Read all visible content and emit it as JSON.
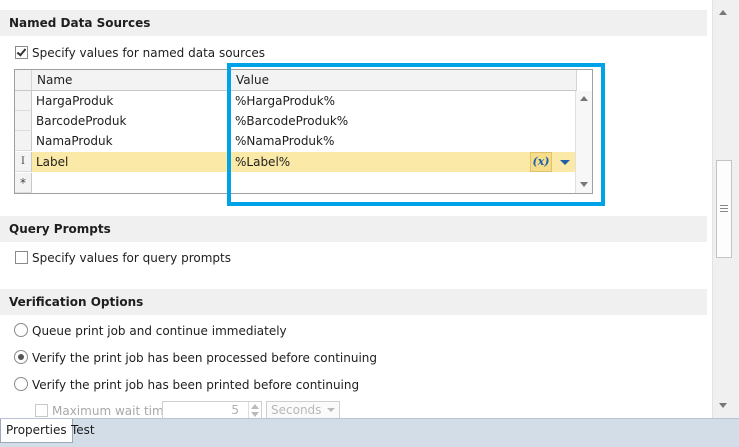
{
  "sections": {
    "named_data_sources": {
      "title": "Named Data Sources",
      "specify_label": "Specify values for named data sources",
      "specify_checked": true,
      "grid": {
        "columns": [
          "Name",
          "Value"
        ],
        "rows": [
          {
            "name": "HargaProduk",
            "value": "%HargaProduk%"
          },
          {
            "name": "BarcodeProduk",
            "value": "%BarcodeProduk%"
          },
          {
            "name": "NamaProduk",
            "value": "%NamaProduk%"
          },
          {
            "name": "Label",
            "value": "%Label%"
          }
        ],
        "active_row_index": 3,
        "new_row_marker": "*",
        "edit_marker": "I",
        "fx_label": "(x)"
      }
    },
    "query_prompts": {
      "title": "Query Prompts",
      "specify_label": "Specify values for query prompts",
      "specify_checked": false
    },
    "verification": {
      "title": "Verification Options",
      "options": [
        {
          "label": "Queue print job and continue immediately",
          "selected": false
        },
        {
          "label": "Verify the print job has been processed before continuing",
          "selected": true
        },
        {
          "label": "Verify the print job has been printed before continuing",
          "selected": false
        }
      ],
      "max_wait_label": "Maximum wait time",
      "max_wait_value": "5",
      "max_wait_unit": "Seconds"
    }
  },
  "tabs": [
    {
      "label": "Properties",
      "active": true
    },
    {
      "label": "Test",
      "active": false
    }
  ],
  "colors": {
    "highlight": "#00a2e8",
    "active_row": "#fbe9a7"
  }
}
